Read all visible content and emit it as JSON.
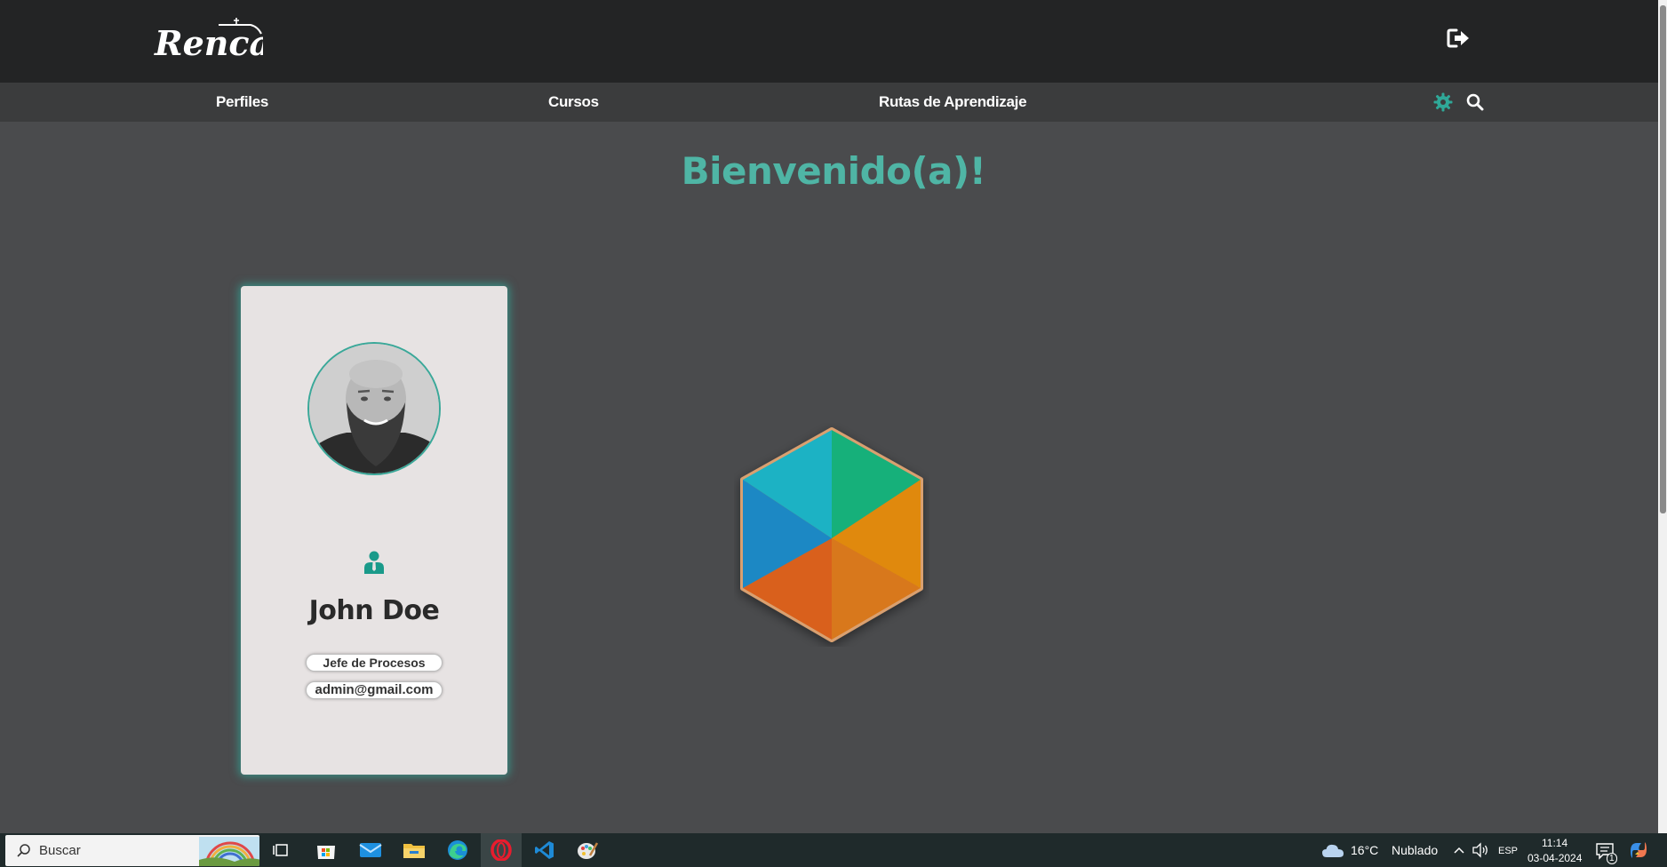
{
  "header": {
    "logo_text": "Renca",
    "logout_icon": "sign-out-icon"
  },
  "nav": {
    "items": [
      {
        "label": "Perfiles"
      },
      {
        "label": "Cursos"
      },
      {
        "label": "Rutas de Aprendizaje"
      }
    ],
    "settings_icon": "gear-icon",
    "search_icon": "search-icon"
  },
  "main": {
    "welcome": "Bienvenido(a)!"
  },
  "profile_card": {
    "name": "John Doe",
    "role": "Jefe de Procesos",
    "email": "admin@gmail.com",
    "role_icon": "user-tie-icon"
  },
  "taskbar": {
    "search_placeholder": "Buscar",
    "weather_temp": "16°C",
    "weather_desc": "Nublado",
    "language": "ESP",
    "time": "11:14",
    "date": "03-04-2024",
    "notification_count": "1",
    "apps": [
      "task-view-icon",
      "microsoft-store-icon",
      "mail-icon",
      "file-explorer-icon",
      "edge-icon",
      "opera-icon",
      "vscode-icon",
      "paint-icon"
    ]
  },
  "colors": {
    "accent": "#4fb5a5",
    "header_bg": "#232425",
    "nav_bg": "#3b3c3d",
    "page_bg": "#4a4b4d",
    "card_bg": "#e7e3e3",
    "taskbar_bg": "#1f2a2b"
  }
}
